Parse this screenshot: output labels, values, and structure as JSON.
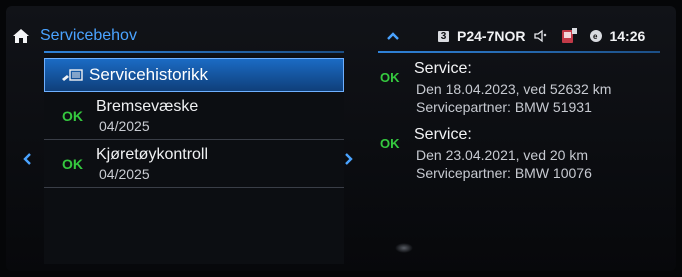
{
  "header": {
    "title": "Servicebehov"
  },
  "status_bar": {
    "badge": "3",
    "plate": "P24-7NOR",
    "time": "14:26"
  },
  "menu": {
    "history_label": "Servicehistorikk",
    "items": [
      {
        "status": "OK",
        "name": "Bremsevæske",
        "date": "04/2025"
      },
      {
        "status": "OK",
        "name": "Kjøretøykontroll",
        "date": "04/2025"
      }
    ]
  },
  "history": [
    {
      "status": "OK",
      "title": "Service:",
      "line1": "Den 18.04.2023, ved 52632 km",
      "line2": "Servicepartner: BMW 51931"
    },
    {
      "status": "OK",
      "title": "Service:",
      "line1": "Den 23.04.2021, ved 20 km",
      "line2": "Servicepartner: BMW 10076"
    }
  ],
  "colors": {
    "accent": "#4aa3ff",
    "ok": "#35c93f",
    "selected": "#1b6bc4"
  },
  "icons": [
    "home-icon",
    "chevron-up-icon",
    "speaker-icon",
    "phone-icon",
    "connectivity-icon",
    "service-doc-icon",
    "chevron-left-icon",
    "chevron-right-icon"
  ]
}
